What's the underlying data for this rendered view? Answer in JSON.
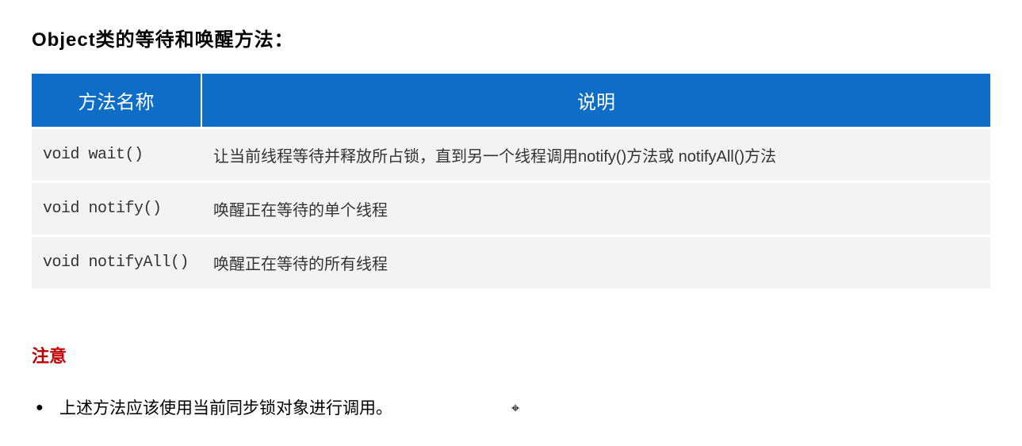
{
  "title": "Object类的等待和唤醒方法：",
  "table": {
    "headers": {
      "method": "方法名称",
      "description": "说明"
    },
    "rows": [
      {
        "method": "void wait()",
        "description": "让当前线程等待并释放所占锁，直到另一个线程调用notify()方法或 notifyAll()方法"
      },
      {
        "method": "void notify()",
        "description": "唤醒正在等待的单个线程"
      },
      {
        "method": "void notifyAll()",
        "description": "唤醒正在等待的所有线程"
      }
    ]
  },
  "notice": {
    "title": "注意",
    "items": [
      "上述方法应该使用当前同步锁对象进行调用。"
    ]
  }
}
